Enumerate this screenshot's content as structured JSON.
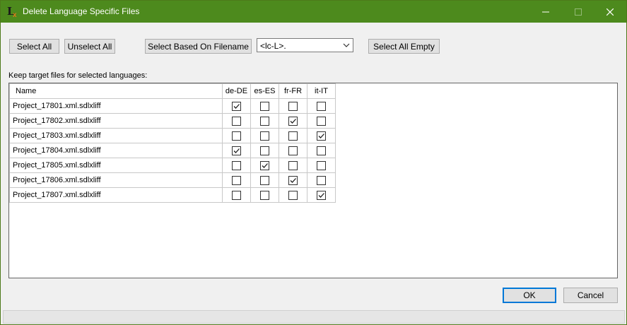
{
  "window": {
    "title": "Delete Language Specific Files",
    "icon_letter": "L",
    "icon_sub": "x",
    "controls": [
      "minimize-icon",
      "maximize-icon",
      "close-icon"
    ]
  },
  "toolbar": {
    "select_all_label": "Select All",
    "unselect_all_label": "Unselect All",
    "select_based_label": "Select Based On Filename",
    "pattern_value": "<lc-L>.",
    "select_empty_label": "Select All Empty"
  },
  "grid_label": "Keep target files for selected languages:",
  "grid": {
    "columns": [
      "Name",
      "de-DE",
      "es-ES",
      "fr-FR",
      "it-IT"
    ],
    "rows": [
      {
        "name": "Project_17801.xml.sdlxliff",
        "checks": [
          true,
          false,
          false,
          false
        ]
      },
      {
        "name": "Project_17802.xml.sdlxliff",
        "checks": [
          false,
          false,
          true,
          false
        ]
      },
      {
        "name": "Project_17803.xml.sdlxliff",
        "checks": [
          false,
          false,
          false,
          true
        ]
      },
      {
        "name": "Project_17804.xml.sdlxliff",
        "checks": [
          true,
          false,
          false,
          false
        ]
      },
      {
        "name": "Project_17805.xml.sdlxliff",
        "checks": [
          false,
          true,
          false,
          false
        ]
      },
      {
        "name": "Project_17806.xml.sdlxliff",
        "checks": [
          false,
          false,
          true,
          false
        ]
      },
      {
        "name": "Project_17807.xml.sdlxliff",
        "checks": [
          false,
          false,
          false,
          true
        ]
      }
    ]
  },
  "footer": {
    "ok_label": "OK",
    "cancel_label": "Cancel"
  },
  "colors": {
    "titlebar": "#4d8a1d",
    "default_button_border": "#0078d7"
  }
}
